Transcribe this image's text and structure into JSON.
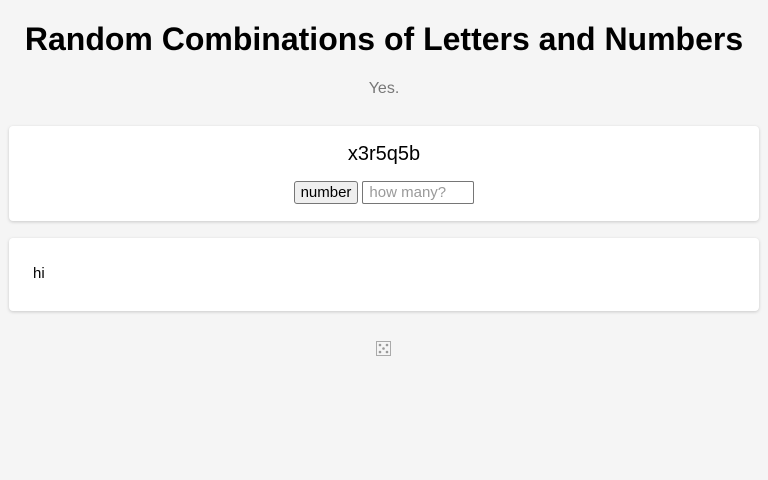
{
  "header": {
    "title": "Random Combinations of Letters and Numbers",
    "subtitle": "Yes."
  },
  "generator": {
    "result": "x3r5q5b",
    "number_button_label": "number",
    "count_input_value": "",
    "count_input_placeholder": "how many?"
  },
  "message": {
    "text": "hi"
  },
  "footer": {
    "icon": "dice-icon"
  }
}
